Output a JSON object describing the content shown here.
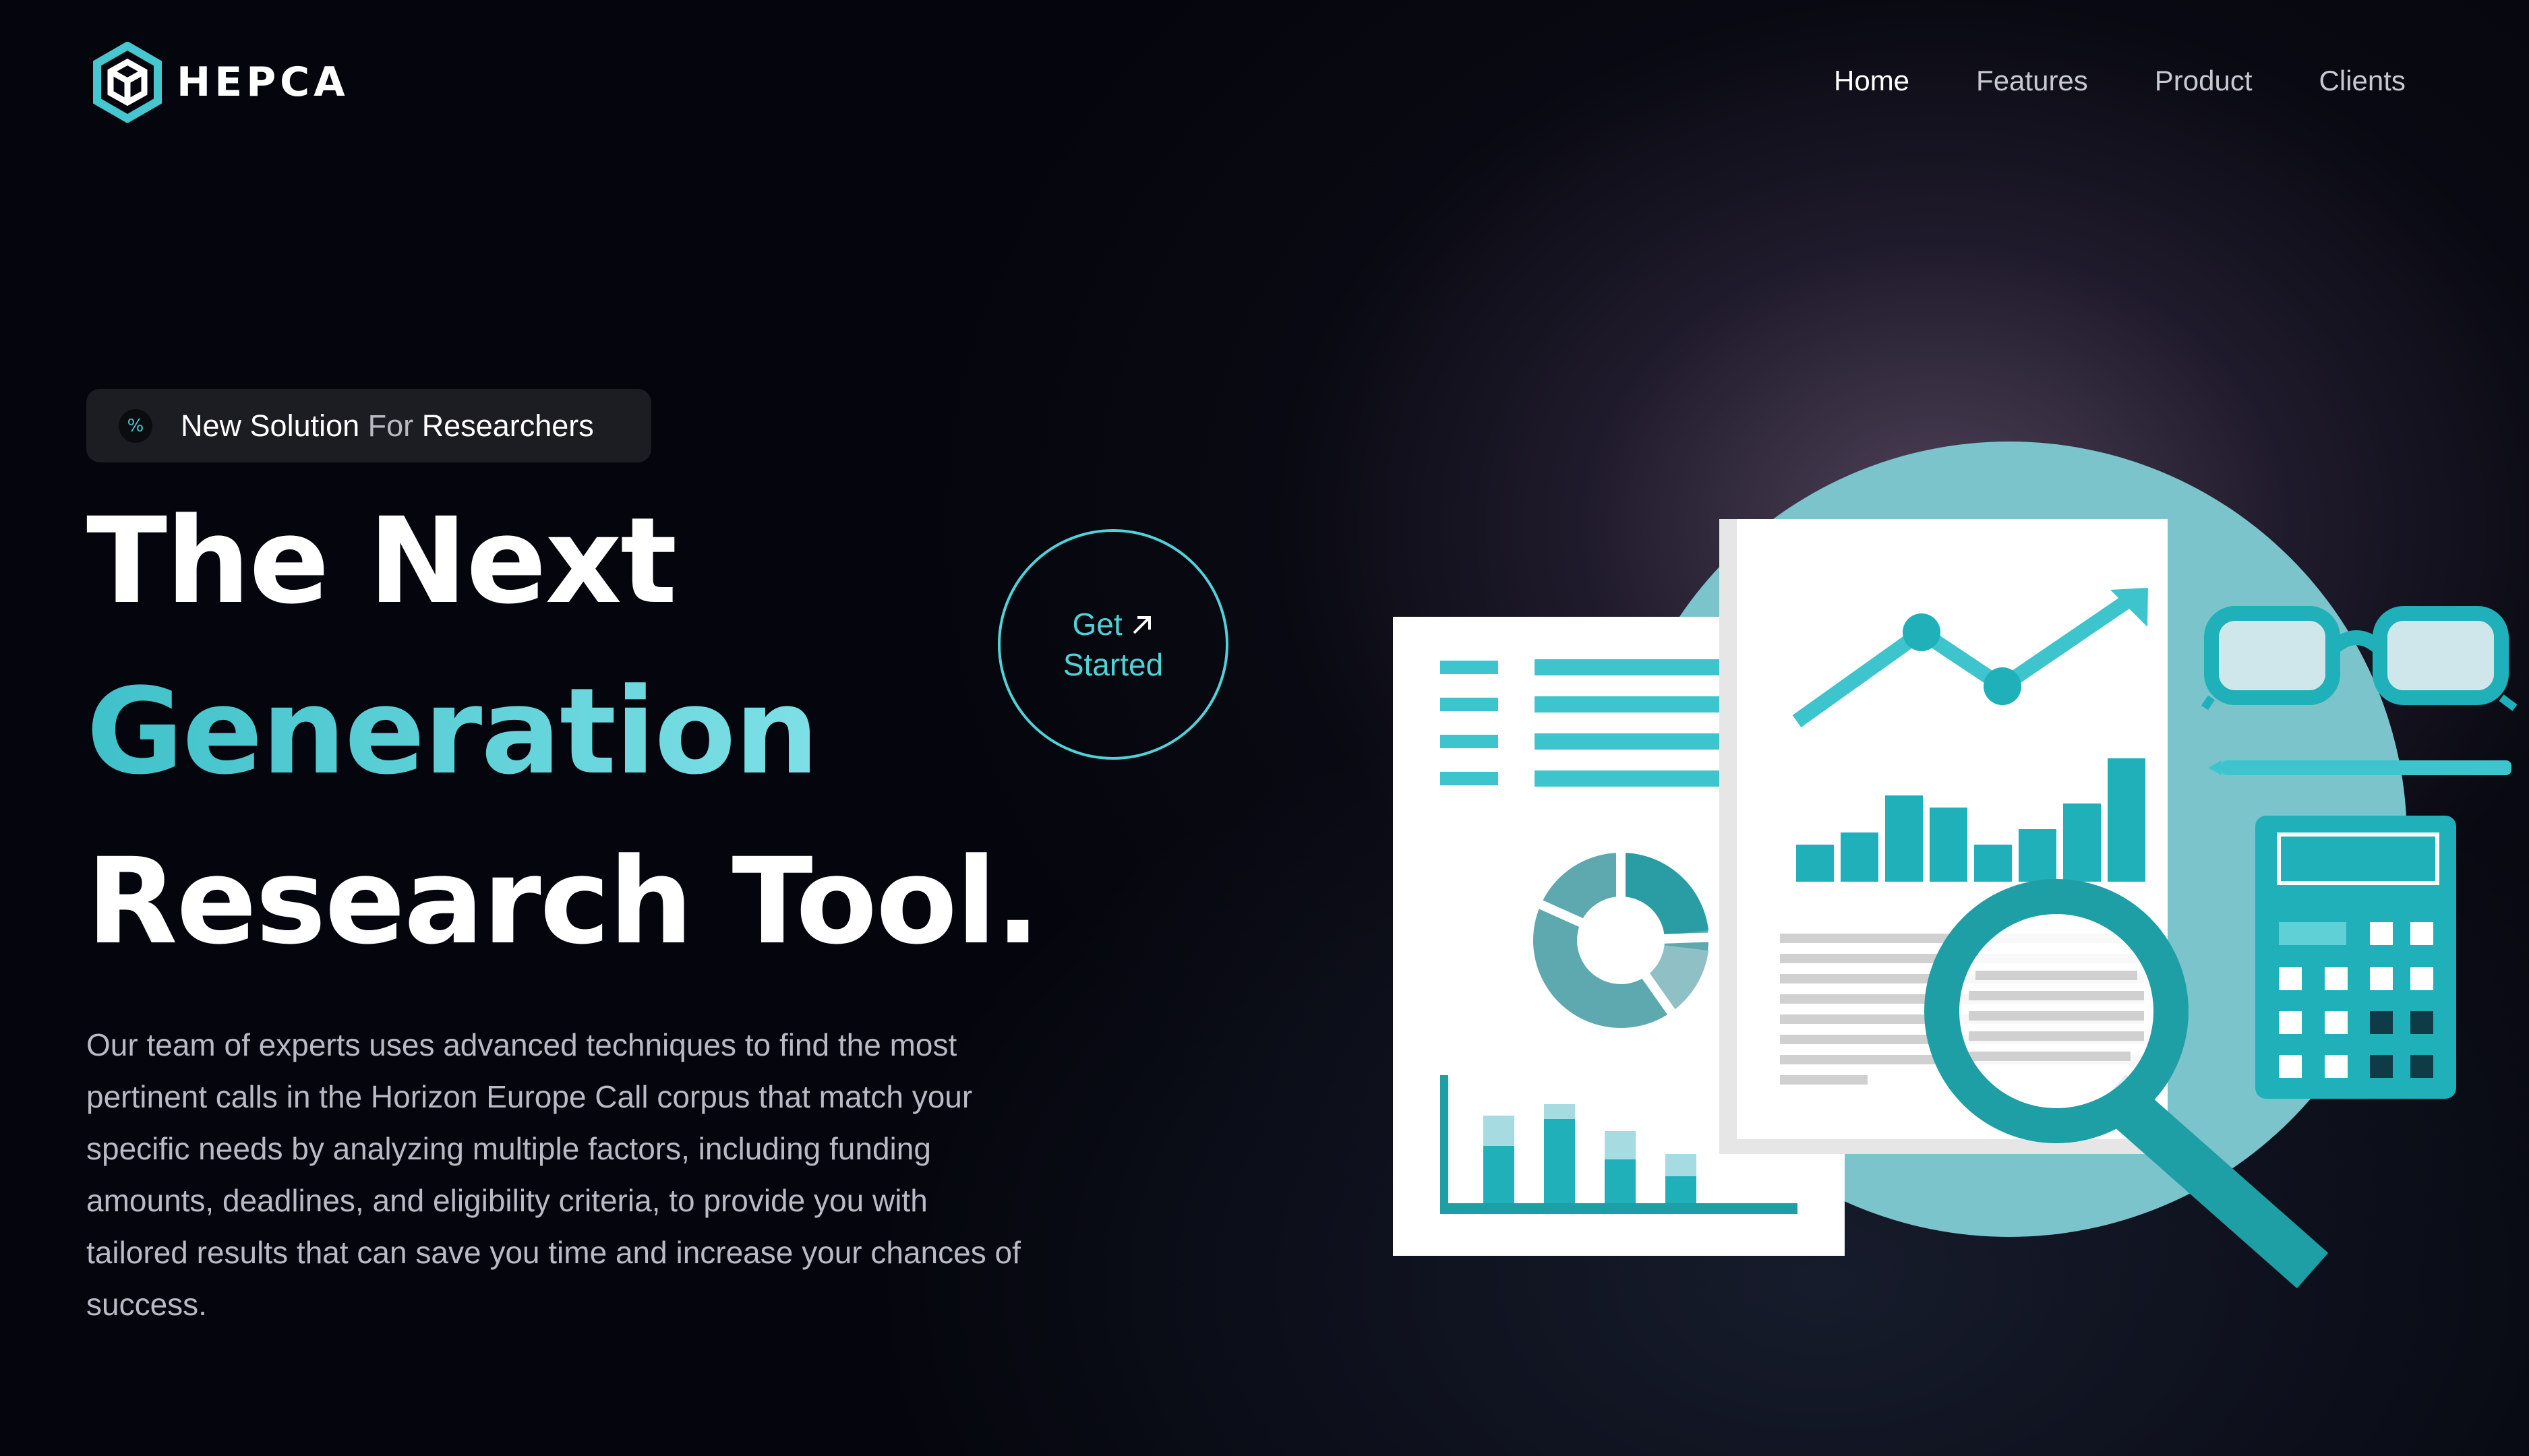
{
  "brand": {
    "name": "HEPCA"
  },
  "nav": {
    "items": [
      {
        "label": "Home",
        "active": true
      },
      {
        "label": "Features",
        "active": false
      },
      {
        "label": "Product",
        "active": false
      },
      {
        "label": "Clients",
        "active": false
      }
    ]
  },
  "hero": {
    "badge": {
      "icon": "percent-icon",
      "text_a": "New Solution",
      "text_b": "For",
      "text_c": "Researchers"
    },
    "headline": [
      "The Next",
      "Generation",
      "Research Tool."
    ],
    "description": "Our team of experts uses advanced techniques to find the most pertinent calls in the Horizon Europe Call corpus that match your specific needs by analyzing multiple factors, including funding amounts, deadlines, and eligibility criteria, to provide you with tailored results that can save you time and increase your chances of success.",
    "cta": {
      "line1": "Get",
      "line2": "Started",
      "icon": "arrow-up-right-icon"
    }
  },
  "colors": {
    "accent": "#46c7cf",
    "background": "#05060d",
    "teal_dark": "#1e9ea5",
    "teal_light": "#7cc4cc"
  }
}
